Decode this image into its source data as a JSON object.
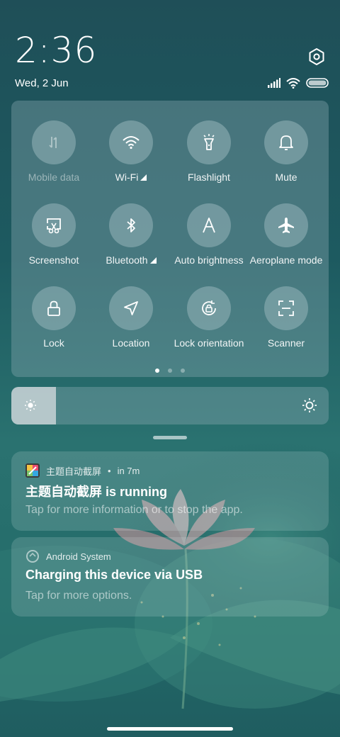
{
  "status": {
    "time": "2:36",
    "date": "Wed, 2 Jun",
    "icons": [
      "signal-icon",
      "wifi-icon",
      "battery-icon"
    ]
  },
  "quick_settings": {
    "tiles": [
      {
        "label": "Mobile data",
        "icon": "mobile-data-icon",
        "state": "disabled"
      },
      {
        "label": "Wi-Fi",
        "icon": "wifi-icon",
        "state": "on",
        "has_menu": true
      },
      {
        "label": "Flashlight",
        "icon": "flashlight-icon",
        "state": "off"
      },
      {
        "label": "Mute",
        "icon": "bell-icon",
        "state": "off"
      },
      {
        "label": "Screenshot",
        "icon": "screenshot-icon",
        "state": "off"
      },
      {
        "label": "Bluetooth",
        "icon": "bluetooth-icon",
        "state": "off",
        "has_menu": true
      },
      {
        "label": "Auto brightness",
        "icon": "auto-brightness-icon",
        "state": "off"
      },
      {
        "label": "Aeroplane mode",
        "icon": "airplane-icon",
        "state": "off"
      },
      {
        "label": "Lock",
        "icon": "lock-icon",
        "state": "off"
      },
      {
        "label": "Location",
        "icon": "location-icon",
        "state": "off"
      },
      {
        "label": "Lock orientation",
        "icon": "rotation-lock-icon",
        "state": "off"
      },
      {
        "label": "Scanner",
        "icon": "scanner-icon",
        "state": "off"
      }
    ],
    "pages": 3,
    "current_page": 1
  },
  "brightness": {
    "level": 0.14
  },
  "notifications": [
    {
      "app": "主题自动截屏",
      "time": "in 7m",
      "separator": "•",
      "title": "主题自动截屏 is running",
      "body": "Tap for more information or to stop the app."
    },
    {
      "app": "Android System",
      "title": "Charging this device via USB",
      "body": "Tap for more options."
    }
  ],
  "colors": {
    "panel": "#8caab2",
    "accent": "#ffffff"
  }
}
